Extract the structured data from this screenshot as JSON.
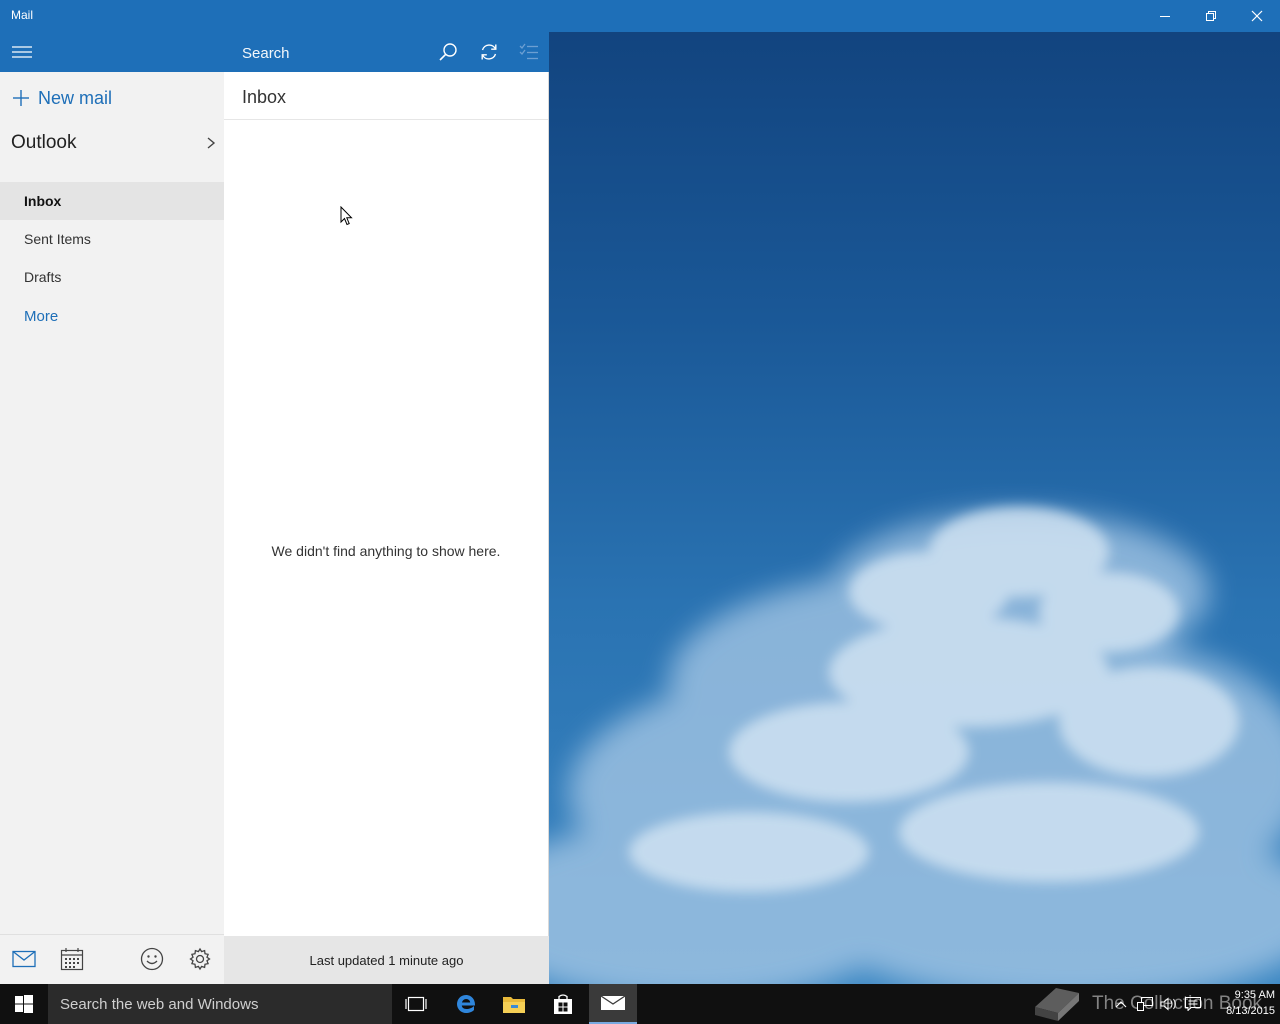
{
  "window": {
    "title": "Mail",
    "controls": [
      "minimize-icon",
      "restore-icon",
      "close-icon"
    ]
  },
  "nav": {
    "new_mail_label": "New mail",
    "account_name": "Outlook",
    "folders": [
      {
        "label": "Inbox",
        "selected": true
      },
      {
        "label": "Sent Items",
        "selected": false
      },
      {
        "label": "Drafts",
        "selected": false
      },
      {
        "label": "More",
        "selected": false
      }
    ],
    "bottom_icons": [
      "mail-icon",
      "calendar-icon",
      "feedback-smiley-icon",
      "settings-gear-icon"
    ]
  },
  "list": {
    "search_placeholder": "Search",
    "header": "Inbox",
    "empty_message": "We didn't find anything to show here.",
    "status": "Last updated 1 minute ago"
  },
  "taskbar": {
    "search_placeholder": "Search the web and Windows",
    "apps": [
      "task-view-icon",
      "edge-icon",
      "file-explorer-icon",
      "store-icon",
      "mail-app-icon"
    ],
    "time": "9:35 AM",
    "date": "8/13/2015",
    "watermark": "The Collection Book"
  },
  "colors": {
    "accent": "#1e6fb8",
    "nav_bg": "#f2f2f2",
    "selected_bg": "#e4e4e4",
    "taskbar_bg": "#101010"
  }
}
